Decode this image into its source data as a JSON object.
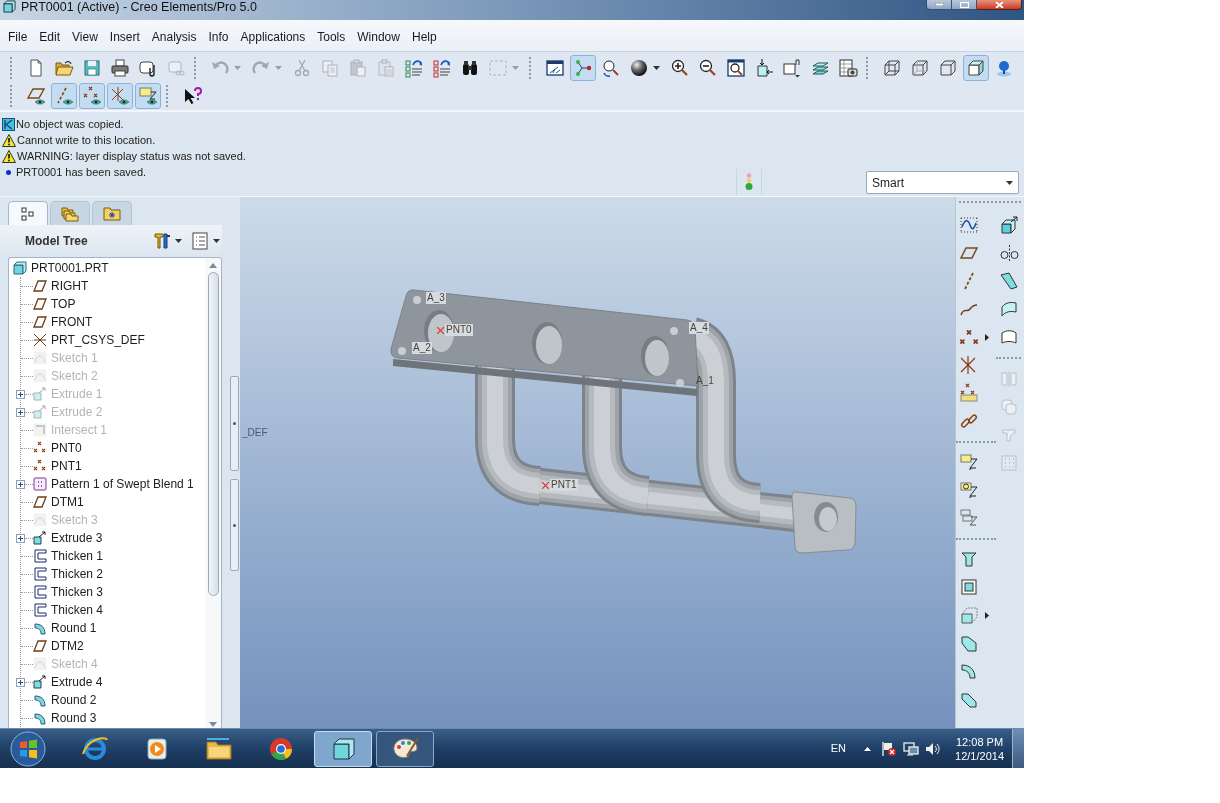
{
  "window": {
    "title": "PRT0001 (Active) - Creo Elements/Pro 5.0"
  },
  "menu": [
    "File",
    "Edit",
    "View",
    "Insert",
    "Analysis",
    "Info",
    "Applications",
    "Tools",
    "Window",
    "Help"
  ],
  "toolbar": {
    "row_1": [
      {
        "on": false,
        "disabled": false
      },
      {
        "on": false,
        "disabled": false
      },
      {
        "on": false,
        "disabled": false
      },
      {
        "on": false,
        "disabled": false
      },
      {
        "on": false,
        "disabled": false
      },
      {
        "on": false,
        "disabled": true
      },
      {
        "on": false,
        "disabled": true
      },
      {
        "on": false,
        "disabled": true
      },
      {
        "on": false,
        "disabled": true
      },
      {
        "on": false,
        "disabled": true
      },
      {
        "on": false,
        "disabled": true
      },
      {
        "on": false,
        "disabled": true
      },
      {
        "on": false,
        "disabled": false
      },
      {
        "on": false,
        "disabled": false
      },
      {
        "on": false,
        "disabled": false
      },
      {
        "on": false,
        "disabled": true
      },
      {
        "on": false,
        "disabled": false
      },
      {
        "on": true,
        "disabled": false
      },
      {
        "on": false,
        "disabled": false
      },
      {
        "on": false,
        "disabled": false
      },
      {
        "on": false,
        "disabled": false
      },
      {
        "on": false,
        "disabled": false
      },
      {
        "on": false,
        "disabled": false
      },
      {
        "on": false,
        "disabled": false
      },
      {
        "on": false,
        "disabled": false
      },
      {
        "on": false,
        "disabled": false
      },
      {
        "on": false,
        "disabled": false
      },
      {
        "on": false,
        "disabled": false
      },
      {
        "on": false,
        "disabled": false
      },
      {
        "on": false,
        "disabled": false
      },
      {
        "on": true,
        "disabled": false
      },
      {
        "on": false,
        "disabled": false
      }
    ],
    "row_2": [
      {
        "on": false,
        "disabled": false
      },
      {
        "on": true,
        "disabled": false
      },
      {
        "on": true,
        "disabled": false
      },
      {
        "on": true,
        "disabled": false
      },
      {
        "on": true,
        "disabled": false
      },
      {
        "on": false,
        "disabled": false
      }
    ]
  },
  "messages": [
    {
      "kind": "info",
      "text": "No object was copied."
    },
    {
      "kind": "warning",
      "text": "Cannot write to this location."
    },
    {
      "kind": "warning",
      "text": "WARNING: layer display status was not saved."
    },
    {
      "kind": "note",
      "text": "PRT0001 has been saved."
    }
  ],
  "selection_filter": {
    "value": "Smart"
  },
  "navigator": {
    "tabs": [
      {
        "selected": true
      },
      {
        "selected": false
      },
      {
        "selected": false
      }
    ],
    "title": "Model Tree"
  },
  "model_tree": [
    {
      "label": "PRT0001.PRT",
      "kind": "part",
      "dimmed": false,
      "children": [
        {
          "label": "RIGHT",
          "kind": "plane",
          "dimmed": false
        },
        {
          "label": "TOP",
          "kind": "plane",
          "dimmed": false
        },
        {
          "label": "FRONT",
          "kind": "plane",
          "dimmed": false
        },
        {
          "label": "PRT_CSYS_DEF",
          "kind": "csys",
          "dimmed": false
        },
        {
          "label": "Sketch 1",
          "kind": "sketch",
          "dimmed": true
        },
        {
          "label": "Sketch 2",
          "kind": "sketch",
          "dimmed": true
        },
        {
          "label": "Extrude 1",
          "kind": "extrude",
          "dimmed": true,
          "expanded": false
        },
        {
          "label": "Extrude 2",
          "kind": "extrude",
          "dimmed": true,
          "expanded": false
        },
        {
          "label": "Intersect 1",
          "kind": "intersect",
          "dimmed": true
        },
        {
          "label": "PNT0",
          "kind": "point",
          "dimmed": false
        },
        {
          "label": "PNT1",
          "kind": "point",
          "dimmed": false
        },
        {
          "label": "Pattern 1 of Swept Blend 1",
          "kind": "pattern",
          "dimmed": false,
          "expanded": false
        },
        {
          "label": "DTM1",
          "kind": "plane",
          "dimmed": false
        },
        {
          "label": "Sketch 3",
          "kind": "sketch",
          "dimmed": true
        },
        {
          "label": "Extrude 3",
          "kind": "extrude",
          "dimmed": false,
          "expanded": false
        },
        {
          "label": "Thicken 1",
          "kind": "thicken",
          "dimmed": false
        },
        {
          "label": "Thicken 2",
          "kind": "thicken",
          "dimmed": false
        },
        {
          "label": "Thicken 3",
          "kind": "thicken",
          "dimmed": false
        },
        {
          "label": "Thicken 4",
          "kind": "thicken",
          "dimmed": false
        },
        {
          "label": "Round 1",
          "kind": "round",
          "dimmed": false
        },
        {
          "label": "DTM2",
          "kind": "plane",
          "dimmed": false
        },
        {
          "label": "Sketch 4",
          "kind": "sketch",
          "dimmed": true
        },
        {
          "label": "Extrude 4",
          "kind": "extrude",
          "dimmed": false,
          "expanded": false
        },
        {
          "label": "Round 2",
          "kind": "round",
          "dimmed": false
        },
        {
          "label": "Round 3",
          "kind": "round",
          "dimmed": false
        }
      ]
    }
  ],
  "viewport": {
    "labels": [
      {
        "kind": "axis",
        "text": "A_3"
      },
      {
        "kind": "point",
        "text": "PNT0"
      },
      {
        "kind": "axis",
        "text": "A_2"
      },
      {
        "kind": "axis",
        "text": "A_4"
      },
      {
        "kind": "axis",
        "text": "A_1"
      },
      {
        "kind": "point",
        "text": "PNT1"
      },
      {
        "kind": "csys",
        "text": "_DEF"
      }
    ]
  },
  "right_toolbar": {
    "column_1": [
      {
        "disabled": false
      },
      {
        "disabled": false
      },
      {
        "disabled": false
      },
      {
        "disabled": false
      },
      {
        "disabled": false
      },
      {
        "disabled": false
      },
      {
        "disabled": false
      },
      {
        "disabled": false
      },
      {
        "disabled": false
      },
      {
        "disabled": false
      },
      {
        "disabled": false
      },
      {
        "disabled": false
      },
      {
        "disabled": false
      },
      {
        "disabled": false
      },
      {
        "disabled": false
      },
      {
        "disabled": false
      },
      {
        "disabled": false
      }
    ],
    "column_2": [
      {
        "disabled": false
      },
      {
        "disabled": false
      },
      {
        "disabled": false
      },
      {
        "disabled": false
      },
      {
        "disabled": false
      },
      {
        "disabled": true
      },
      {
        "disabled": true
      },
      {
        "disabled": true
      },
      {
        "disabled": true
      }
    ]
  },
  "taskbar": {
    "apps": [
      {
        "selected": false,
        "running": false
      },
      {
        "selected": false,
        "running": false
      },
      {
        "selected": false,
        "running": false
      },
      {
        "selected": false,
        "running": false
      },
      {
        "selected": true,
        "running": true
      },
      {
        "selected": false,
        "running": true
      }
    ],
    "language": "EN",
    "time": "12:08 PM",
    "date": "12/1/2014"
  }
}
